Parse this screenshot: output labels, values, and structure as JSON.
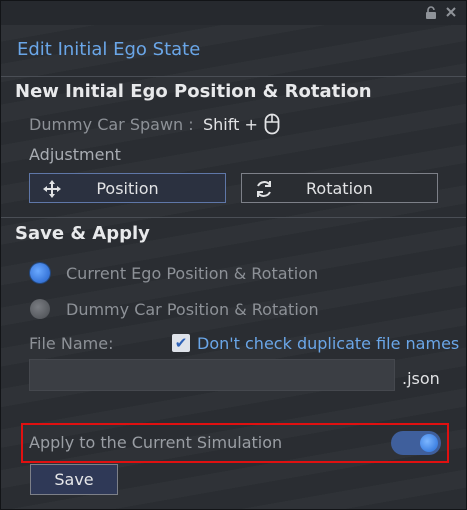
{
  "window": {
    "panel_title": "Edit Initial Ego State"
  },
  "position_section": {
    "title": "New Initial Ego Position & Rotation",
    "spawn_label": "Dummy Car Spawn :",
    "spawn_shortcut": "Shift +",
    "spawn_shortcut_icon": "mouse-icon",
    "adjustment_label": "Adjustment",
    "buttons": [
      {
        "label": "Position",
        "icon": "move-arrows-icon",
        "selected": true
      },
      {
        "label": "Rotation",
        "icon": "rotate-icon",
        "selected": false
      }
    ]
  },
  "apply_section": {
    "title": "Save & Apply",
    "options": [
      {
        "label": "Current Ego Position & Rotation",
        "selected": true
      },
      {
        "label": "Dummy Car Position & Rotation",
        "selected": false
      }
    ],
    "file_name_label": "File Name:",
    "duplicate_check_label": "Don't check duplicate file names",
    "duplicate_check_checked": true,
    "file_name_value": "",
    "file_extension": ".json",
    "apply_current_label": "Apply to the Current Simulation",
    "apply_current_enabled": true,
    "save_label": "Save"
  },
  "colors": {
    "accent": "#6aa6e8",
    "highlight_border": "#e01010",
    "toggle_on": "#3f5f9c"
  }
}
